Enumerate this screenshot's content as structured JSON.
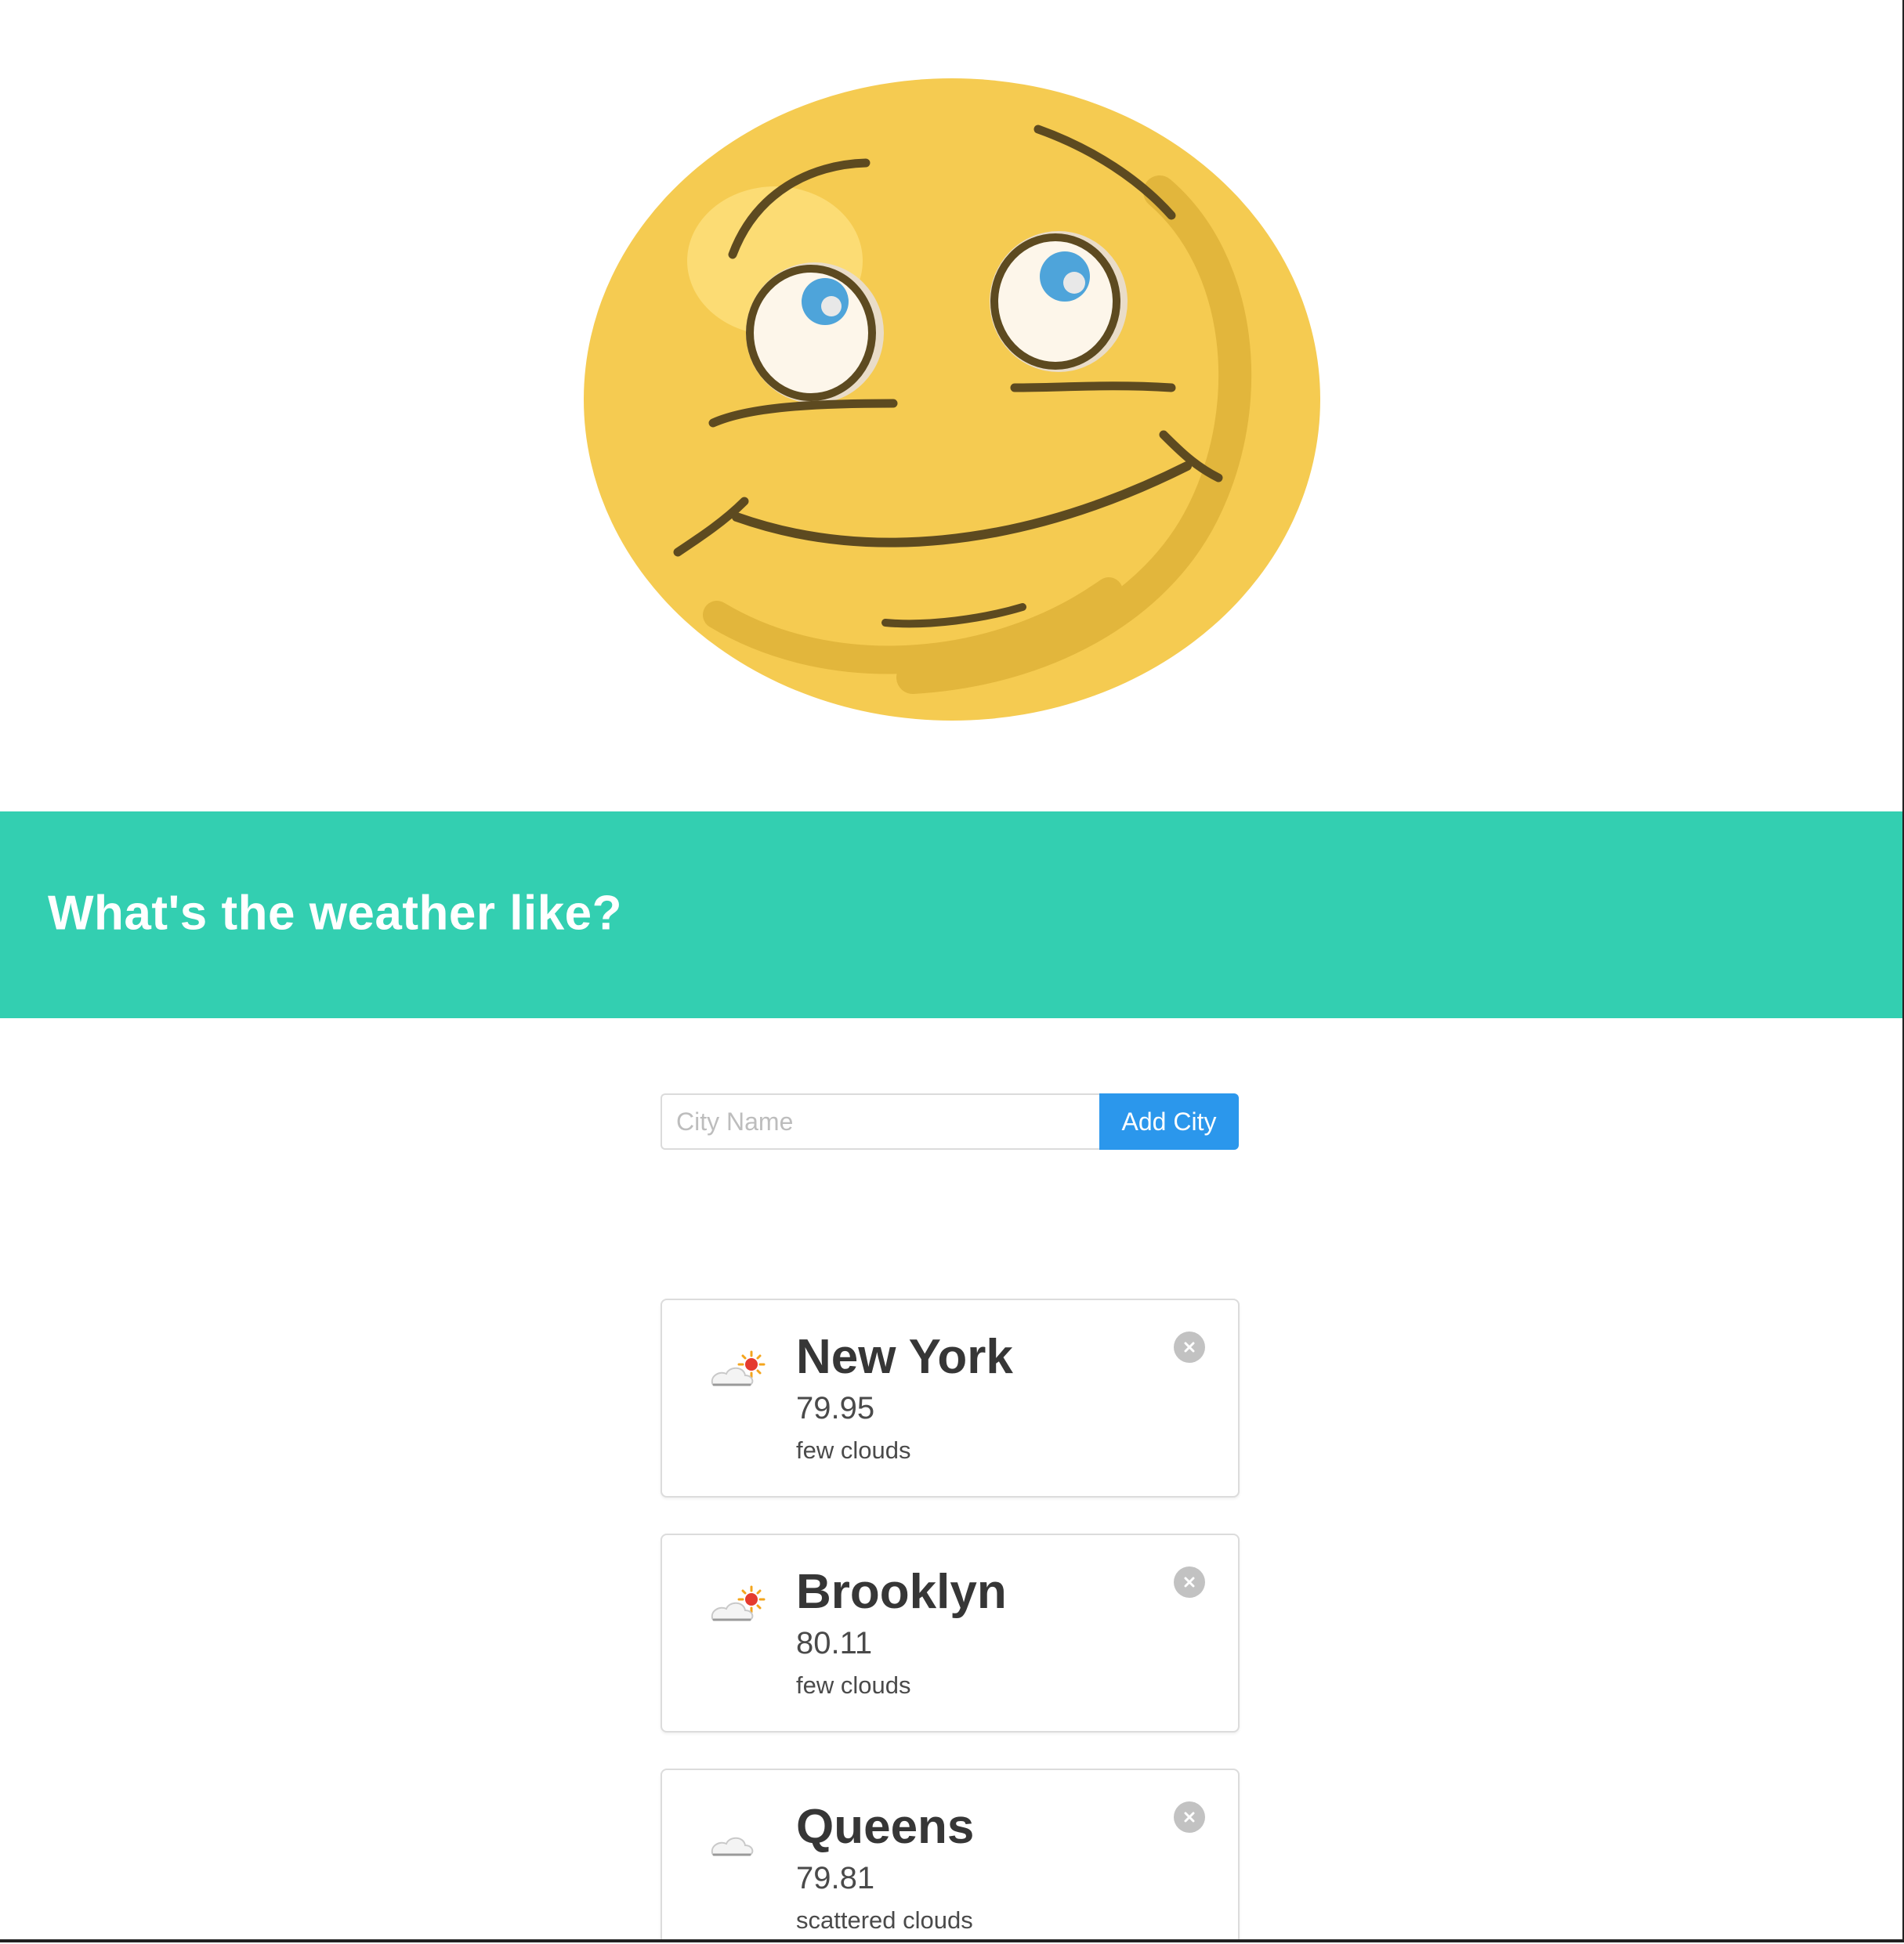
{
  "header": {
    "title": "What's the weather like?"
  },
  "form": {
    "input_placeholder": "City Name",
    "input_value": "",
    "add_button_label": "Add City"
  },
  "cities": [
    {
      "name": "New York",
      "temperature": "79.95",
      "description": "few clouds",
      "icon": "partly-cloudy-sun-icon"
    },
    {
      "name": "Brooklyn",
      "temperature": "80.11",
      "description": "few clouds",
      "icon": "partly-cloudy-sun-icon"
    },
    {
      "name": "Queens",
      "temperature": "79.81",
      "description": "scattered clouds",
      "icon": "cloud-icon"
    }
  ],
  "colors": {
    "banner": "#33cfb1",
    "button": "#2b97ec",
    "face": "#f5cb51"
  }
}
